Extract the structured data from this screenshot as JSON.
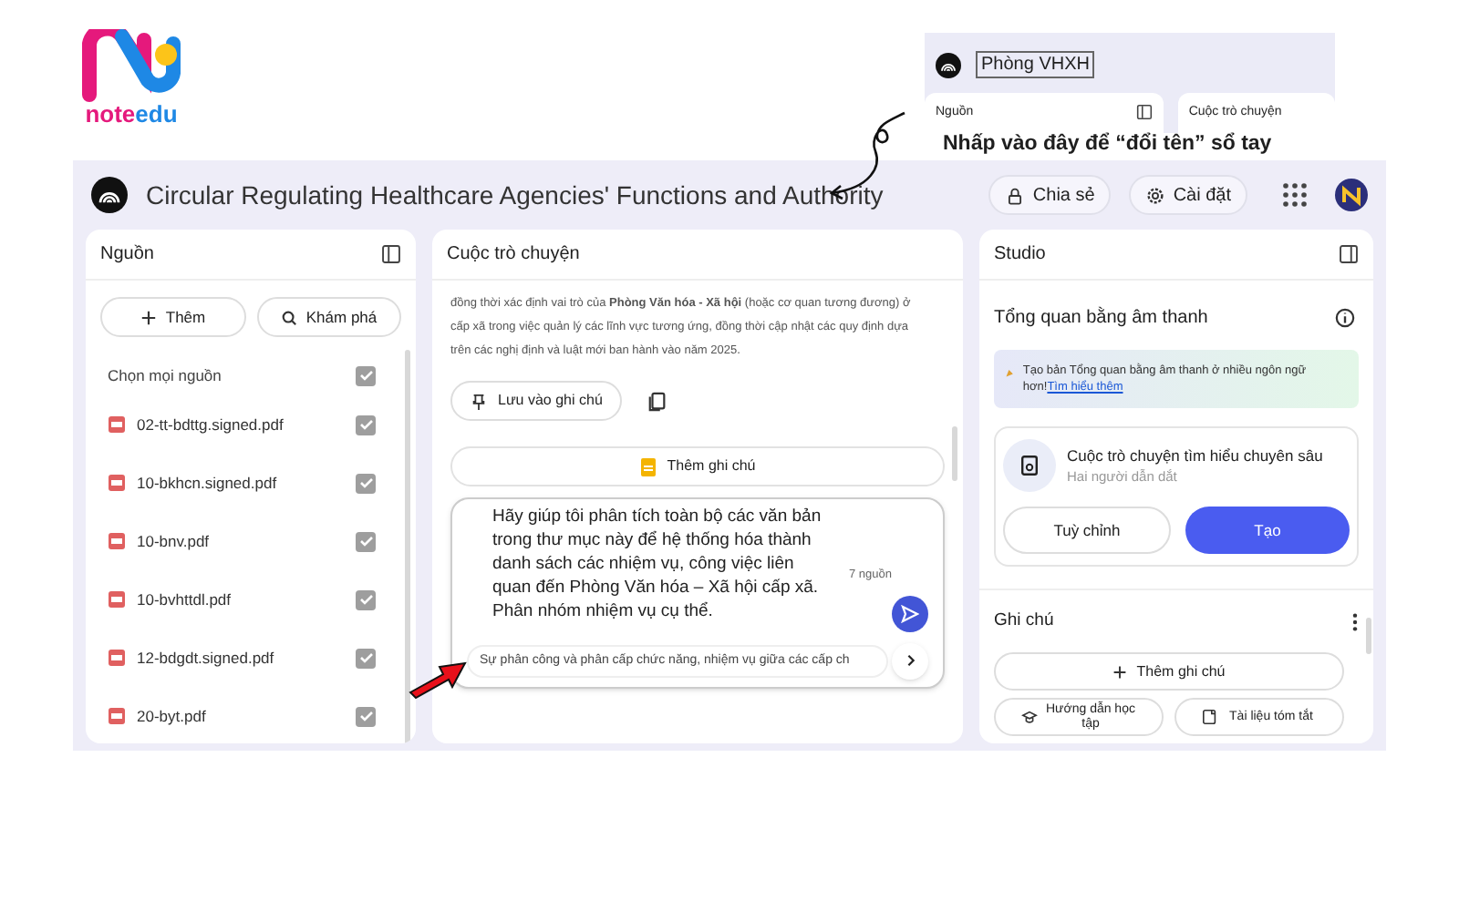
{
  "logo": {
    "text": "noteedu"
  },
  "inset": {
    "notebook_name": "Phòng VHXH",
    "panels": [
      "Nguồn",
      "Cuộc trò chuyện"
    ]
  },
  "annotation": "Nhấp vào đây để “đổi tên” sổ tay",
  "app": {
    "title": "Circular Regulating Healthcare Agencies' Functions and Authority",
    "header_buttons": [
      {
        "label": "Chia sẻ",
        "kind": "share"
      },
      {
        "label": "Cài đặt",
        "kind": "settings"
      }
    ]
  },
  "sources": {
    "title": "Nguồn",
    "buttons": [
      {
        "label": "Thêm",
        "kind": "add"
      },
      {
        "label": "Khám phá",
        "kind": "discover"
      }
    ],
    "select_all": {
      "label": "Chọn mọi nguồn",
      "checked": true
    },
    "items": [
      {
        "name": "02-tt-bdttg.signed.pdf",
        "checked": true
      },
      {
        "name": "10-bkhcn.signed.pdf",
        "checked": true
      },
      {
        "name": "10-bnv.pdf",
        "checked": true
      },
      {
        "name": "10-bvhttdl.pdf",
        "checked": true
      },
      {
        "name": "12-bdgdt.signed.pdf",
        "checked": true
      },
      {
        "name": "20-byt.pdf",
        "checked": true
      }
    ]
  },
  "chat": {
    "title": "Cuộc trò chuyện",
    "message": "đồng thời xác định vai trò của **Phòng Văn hóa - Xã hội** (hoặc cơ quan tương đương) ở cấp xã trong việc quản lý các lĩnh vực tương ứng, đồng thời cập nhật các quy định dựa trên các nghị định và luật mới ban hành vào năm 2025.",
    "save_button": "Lưu vào ghi chú",
    "add_note_button": "Thêm ghi chú",
    "input": "Hãy giúp tôi phân tích toàn bộ các văn bản\ntrong thư mục này để hệ thống hóa thành\ndanh sách các nhiệm vụ, công việc liên\nquan đến Phòng Văn hóa – Xã hội cấp xã.\n Phân nhóm nhiệm vụ cụ thể.",
    "source_count": "7 nguồn",
    "suggestion": "Sự phân công và phân cấp chức năng, nhiệm vụ giữa các cấp ch"
  },
  "studio": {
    "title": "Studio",
    "audio_title": "Tổng quan bằng âm thanh",
    "banner": {
      "text": "Tạo bản Tổng quan bằng âm thanh ở nhiều ngôn ngữ hơn!",
      "link": "Tìm hiểu thêm"
    },
    "card": {
      "title": "Cuộc trò chuyện tìm hiểu chuyên sâu",
      "subtitle": "Hai người dẫn dắt"
    },
    "buttons": [
      {
        "label": "Tuỳ chỉnh",
        "kind": "secondary"
      },
      {
        "label": "Tạo",
        "kind": "primary"
      }
    ],
    "notes_title": "Ghi chú",
    "add_note": "Thêm ghi chú",
    "note_buttons": [
      {
        "label": "Hướng dẫn học tập",
        "kind": "guide"
      },
      {
        "label": "Tài liệu tóm tắt",
        "kind": "summary"
      }
    ]
  }
}
